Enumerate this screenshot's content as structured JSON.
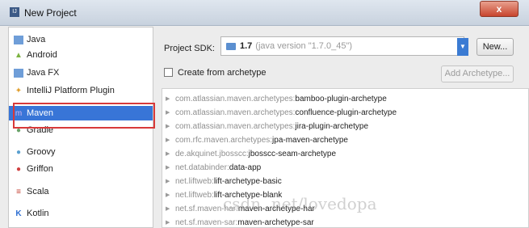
{
  "window": {
    "title": "New Project",
    "close_glyph": "x"
  },
  "sidebar": {
    "items": [
      {
        "label": "Java",
        "icon": "java-folder-icon",
        "color": "#4a7fc1"
      },
      {
        "label": "Android",
        "icon": "android-icon",
        "color": "#7cb342"
      },
      {
        "label": "Java FX",
        "icon": "javafx-folder-icon",
        "color": "#4a7fc1"
      },
      {
        "label": "IntelliJ Platform Plugin",
        "icon": "plugin-icon",
        "color": "#e0a030"
      },
      {
        "label": "Maven",
        "icon": "maven-icon",
        "color": "#a86bc7",
        "selected": true
      },
      {
        "label": "Gradle",
        "icon": "gradle-icon",
        "color": "#6aa36a"
      },
      {
        "label": "Groovy",
        "icon": "groovy-icon",
        "color": "#5aa0d0"
      },
      {
        "label": "Griffon",
        "icon": "griffon-icon",
        "color": "#d04040"
      },
      {
        "label": "Scala",
        "icon": "scala-icon",
        "color": "#c0392b"
      },
      {
        "label": "Kotlin",
        "icon": "kotlin-icon",
        "color": "#2e6fd2"
      }
    ]
  },
  "sdk": {
    "label": "Project SDK:",
    "version": "1.7",
    "description": "(java version \"1.7.0_45\")",
    "new_button": "New..."
  },
  "archetype": {
    "checkbox_label": "Create from archetype",
    "checked": false,
    "add_button": "Add Archetype..."
  },
  "archetypes": [
    {
      "group": "com.atlassian.maven.archetypes:",
      "artifact": "bamboo-plugin-archetype"
    },
    {
      "group": "com.atlassian.maven.archetypes:",
      "artifact": "confluence-plugin-archetype"
    },
    {
      "group": "com.atlassian.maven.archetypes:",
      "artifact": "jira-plugin-archetype"
    },
    {
      "group": "com.rfc.maven.archetypes:",
      "artifact": "jpa-maven-archetype"
    },
    {
      "group": "de.akquinet.jbosscc:",
      "artifact": "jbosscc-seam-archetype"
    },
    {
      "group": "net.databinder:",
      "artifact": "data-app"
    },
    {
      "group": "net.liftweb:",
      "artifact": "lift-archetype-basic"
    },
    {
      "group": "net.liftweb:",
      "artifact": "lift-archetype-blank"
    },
    {
      "group": "net.sf.maven-har:",
      "artifact": "maven-archetype-har"
    },
    {
      "group": "net.sf.maven-sar:",
      "artifact": "maven-archetype-sar"
    }
  ],
  "watermark": "csdn. net/lovedopa"
}
